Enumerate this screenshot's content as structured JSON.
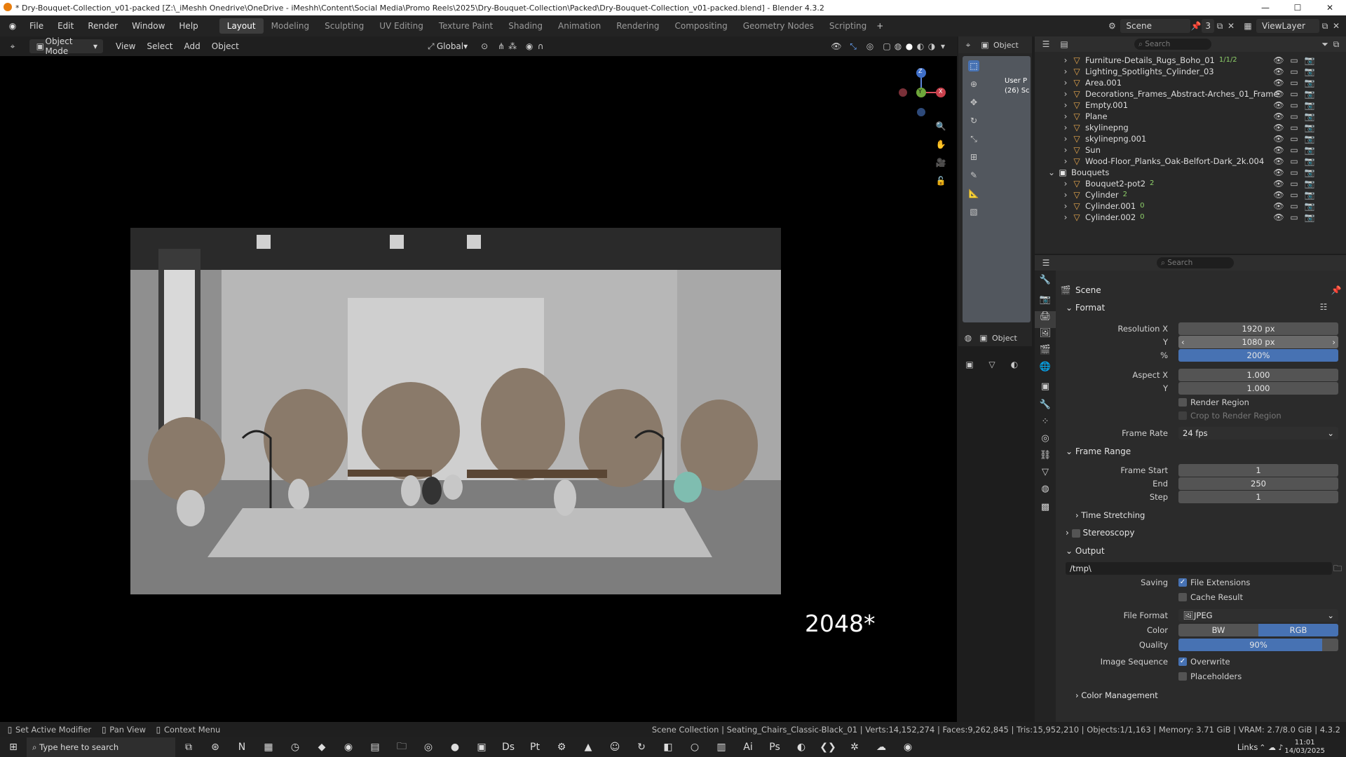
{
  "title_bar": {
    "text": "* Dry-Bouquet-Collection_v01-packed [Z:\\_iMeshh Onedrive\\OneDrive - iMeshh\\Content\\Social Media\\Promo Reels\\2025\\Dry-Bouquet-Collection\\Packed\\Dry-Bouquet-Collection_v01-packed.blend] - Blender 4.3.2"
  },
  "menu": [
    "File",
    "Edit",
    "Render",
    "Window",
    "Help"
  ],
  "workspaces": [
    "Layout",
    "Modeling",
    "Sculpting",
    "UV Editing",
    "Texture Paint",
    "Shading",
    "Animation",
    "Rendering",
    "Compositing",
    "Geometry Nodes",
    "Scripting"
  ],
  "scene": {
    "name": "Scene",
    "count": "3",
    "view_layer": "ViewLayer"
  },
  "viewport_header": {
    "mode": "Object Mode",
    "view": "View",
    "select": "Select",
    "add": "Add",
    "object": "Object",
    "orientation": "Global"
  },
  "overlay_text": "2048*",
  "nav_gizmo": {
    "x": "X",
    "y": "Y",
    "z": "Z"
  },
  "side_header": {
    "object": "Object",
    "object2": "Object",
    "cam_label_1": "User P",
    "cam_label_2": "(26) Sc"
  },
  "outliner": {
    "search": "Search",
    "rows": [
      {
        "name": "Furniture-Details_Rugs_Boho_01",
        "extra": "1/1/2"
      },
      {
        "name": "Lighting_Spotlights_Cylinder_03",
        "extra": ""
      },
      {
        "name": "Area.001",
        "extra": ""
      },
      {
        "name": "Decorations_Frames_Abstract-Arches_01_Frame",
        "extra": ""
      },
      {
        "name": "Empty.001",
        "extra": ""
      },
      {
        "name": "Plane",
        "extra": ""
      },
      {
        "name": "skylinepng",
        "extra": ""
      },
      {
        "name": "skylinepng.001",
        "extra": ""
      },
      {
        "name": "Sun",
        "extra": ""
      },
      {
        "name": "Wood-Floor_Planks_Oak-Belfort-Dark_2k.004",
        "extra": ""
      },
      {
        "name": "Bouquets",
        "extra": ""
      },
      {
        "name": "Bouquet2-pot2",
        "extra": "2"
      },
      {
        "name": "Cylinder",
        "extra": "2"
      },
      {
        "name": "Cylinder.001",
        "extra": "0"
      },
      {
        "name": "Cylinder.002",
        "extra": "0"
      }
    ]
  },
  "properties": {
    "search": "Search",
    "context": "Scene",
    "format": {
      "header": "Format",
      "res_x_label": "Resolution X",
      "res_x": "1920 px",
      "res_y_label": "Y",
      "res_y": "1080 px",
      "pct_label": "%",
      "pct": "200%",
      "aspect_x_label": "Aspect X",
      "aspect_x": "1.000",
      "aspect_y_label": "Y",
      "aspect_y": "1.000",
      "render_region": "Render Region",
      "crop": "Crop to Render Region",
      "frame_rate_label": "Frame Rate",
      "frame_rate": "24 fps"
    },
    "frame_range": {
      "header": "Frame Range",
      "start_label": "Frame Start",
      "start": "1",
      "end_label": "End",
      "end": "250",
      "step_label": "Step",
      "step": "1"
    },
    "time_stretching": "Time Stretching",
    "stereoscopy": "Stereoscopy",
    "output": {
      "header": "Output",
      "path": "/tmp\\",
      "saving_label": "Saving",
      "file_ext": "File Extensions",
      "cache": "Cache Result",
      "format_label": "File Format",
      "format": "JPEG",
      "color_label": "Color",
      "bw": "BW",
      "rgb": "RGB",
      "quality_label": "Quality",
      "quality": "90%",
      "seq_label": "Image Sequence",
      "overwrite": "Overwrite",
      "placeholders": "Placeholders"
    },
    "color_management": "Color Management"
  },
  "status": {
    "left1": "Set Active Modifier",
    "left2": "Pan View",
    "left3": "Context Menu",
    "right": "Scene Collection | Seating_Chairs_Classic-Black_01 | Verts:14,152,274 | Faces:9,262,845 | Tris:15,952,210 | Objects:1/1,163 | Memory: 3.71 GiB | VRAM: 2.7/8.0 GiB | 4.3.2"
  },
  "taskbar": {
    "search": "Type here to search",
    "links": "Links",
    "time": "11:01",
    "date": "14/03/2025"
  }
}
